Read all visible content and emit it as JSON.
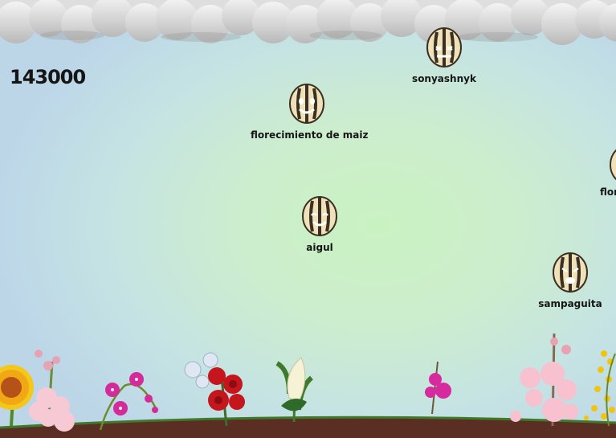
{
  "game": {
    "score": "143000",
    "seeds": [
      {
        "word": "florecimiento de maiz"
      },
      {
        "word": "sonyashnyk"
      },
      {
        "word": "aigul"
      },
      {
        "word": "sampaguita"
      },
      {
        "word": "flor"
      }
    ]
  },
  "icons": {
    "cloud": "cloud-icon",
    "seed": "sunflower-seed-icon",
    "flower": "flower-icon"
  },
  "colors": {
    "seed_body": "#efe2b8",
    "seed_stripe": "#3a2f22",
    "soil": "#5a2e22",
    "grass": "#3f7a2a"
  }
}
